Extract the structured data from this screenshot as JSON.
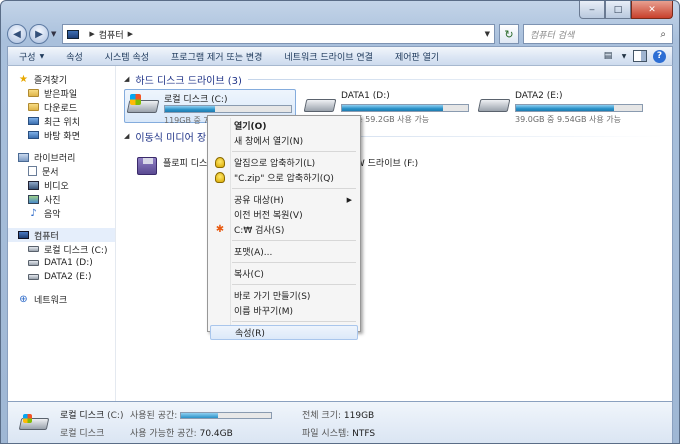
{
  "window": {
    "minimize_glyph": "‒",
    "maximize_glyph": "□",
    "close_glyph": "✕"
  },
  "address": {
    "location": "컴퓨터",
    "search_placeholder": "컴퓨터 검색"
  },
  "toolbar": {
    "items": [
      "구성",
      "속성",
      "시스템 속성",
      "프로그램 제거 또는 변경",
      "네트워크 드라이브 연결",
      "제어판 열기"
    ]
  },
  "sidebar": {
    "favorites": {
      "label": "즐겨찾기",
      "items": [
        "받은파일",
        "다운로드",
        "최근 위치",
        "바탕 화면"
      ]
    },
    "libraries": {
      "label": "라이브러리",
      "items": [
        "문서",
        "비디오",
        "사진",
        "음악"
      ]
    },
    "computer": {
      "label": "컴퓨터",
      "items": [
        "로컬 디스크 (C:)",
        "DATA1 (D:)",
        "DATA2 (E:)"
      ]
    },
    "network": {
      "label": "네트워크"
    }
  },
  "groups": {
    "hdd": "하드 디스크 드라이브 (3)",
    "removable": "이동식 미디어 장"
  },
  "drives": [
    {
      "name": "로컬 디스크 (C:)",
      "free_text": "119GB 중 7",
      "used_fraction": 0.4
    },
    {
      "name": "DATA1 (D:)",
      "free_text": "GB 중 59.2GB 사용 가능",
      "used_fraction": 0.8
    },
    {
      "name": "DATA2 (E:)",
      "free_text": "39.0GB 중 9.54GB 사용 가능",
      "used_fraction": 0.78
    }
  ],
  "removable": [
    {
      "name": "플로피 디스"
    },
    {
      "name": "RW 드라이브 (F:)"
    }
  ],
  "context_menu": {
    "open": "열기(O)",
    "open_new": "새 창에서 열기(N)",
    "zip1": "알집으로 압축하기(L)",
    "zip2": "\"C.zip\" 으로 압축하기(Q)",
    "share": "공유 대상(H)",
    "restore": "이전 버전 복원(V)",
    "v3": "C:₩ 검사(S)",
    "format": "포맷(A)...",
    "copy": "복사(C)",
    "shortcut": "바로 가기 만들기(S)",
    "rename": "이름 바꾸기(M)",
    "properties": "속성(R)"
  },
  "status": {
    "name": "로컬 디스크",
    "letter": "(C:)",
    "type": "로컬 디스크",
    "used_label": "사용된 공간:",
    "free_label": "사용 가능한 공간:",
    "free_value": "70.4GB",
    "total_label": "전체 크기:",
    "total_value": "119GB",
    "fs_label": "파일 시스템:",
    "fs_value": "NTFS",
    "used_fraction": 0.41
  },
  "colors": {
    "accent": "#1e3287",
    "bar": "#2b92c8",
    "selection": "#d9e8f9"
  }
}
